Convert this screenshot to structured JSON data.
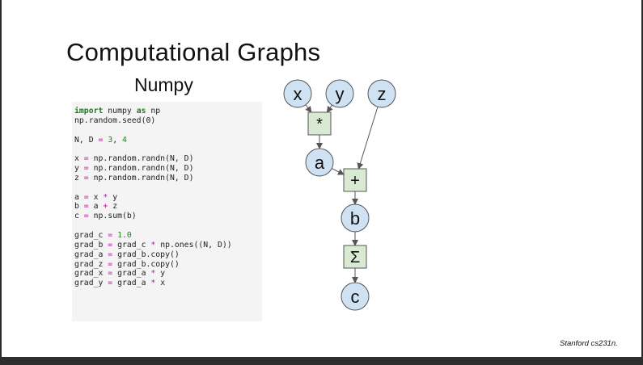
{
  "slide": {
    "title": "Computational Graphs",
    "subtitle": "Numpy",
    "credit": "Stanford cs231n."
  },
  "code": [
    [
      {
        "t": "import",
        "c": "kw"
      },
      {
        "t": " numpy "
      },
      {
        "t": "as",
        "c": "kw"
      },
      {
        "t": " np"
      }
    ],
    [
      {
        "t": "np.random.seed(0)"
      }
    ],
    [],
    [
      {
        "t": "N, D "
      },
      {
        "t": "=",
        "c": "op"
      },
      {
        "t": " "
      },
      {
        "t": "3",
        "c": "num"
      },
      {
        "t": ", "
      },
      {
        "t": "4",
        "c": "num"
      }
    ],
    [],
    [
      {
        "t": "x "
      },
      {
        "t": "=",
        "c": "op"
      },
      {
        "t": " np.random.randn(N, D)"
      }
    ],
    [
      {
        "t": "y "
      },
      {
        "t": "=",
        "c": "op"
      },
      {
        "t": " np.random.randn(N, D)"
      }
    ],
    [
      {
        "t": "z "
      },
      {
        "t": "=",
        "c": "op"
      },
      {
        "t": " np.random.randn(N, D)"
      }
    ],
    [],
    [
      {
        "t": "a "
      },
      {
        "t": "=",
        "c": "op"
      },
      {
        "t": " x "
      },
      {
        "t": "*",
        "c": "op"
      },
      {
        "t": " y"
      }
    ],
    [
      {
        "t": "b "
      },
      {
        "t": "=",
        "c": "op"
      },
      {
        "t": " a "
      },
      {
        "t": "+",
        "c": "op"
      },
      {
        "t": " z"
      }
    ],
    [
      {
        "t": "c "
      },
      {
        "t": "=",
        "c": "op"
      },
      {
        "t": " np.sum(b)"
      }
    ],
    [],
    [
      {
        "t": "grad_c "
      },
      {
        "t": "=",
        "c": "op"
      },
      {
        "t": " "
      },
      {
        "t": "1.0",
        "c": "num"
      }
    ],
    [
      {
        "t": "grad_b "
      },
      {
        "t": "=",
        "c": "op"
      },
      {
        "t": " grad_c "
      },
      {
        "t": "*",
        "c": "op"
      },
      {
        "t": " np.ones((N, D))"
      }
    ],
    [
      {
        "t": "grad_a "
      },
      {
        "t": "=",
        "c": "op"
      },
      {
        "t": " grad_b.copy()"
      }
    ],
    [
      {
        "t": "grad_z "
      },
      {
        "t": "=",
        "c": "op"
      },
      {
        "t": " grad_b.copy()"
      }
    ],
    [
      {
        "t": "grad_x "
      },
      {
        "t": "=",
        "c": "op"
      },
      {
        "t": " grad_a "
      },
      {
        "t": "*",
        "c": "op"
      },
      {
        "t": " y"
      }
    ],
    [
      {
        "t": "grad_y "
      },
      {
        "t": "=",
        "c": "op"
      },
      {
        "t": " grad_a "
      },
      {
        "t": "*",
        "c": "op"
      },
      {
        "t": " x"
      }
    ]
  ],
  "graph": {
    "nodes": [
      {
        "id": "x",
        "label": "x",
        "kind": "variable"
      },
      {
        "id": "y",
        "label": "y",
        "kind": "variable"
      },
      {
        "id": "z",
        "label": "z",
        "kind": "variable"
      },
      {
        "id": "mul",
        "label": "*",
        "kind": "operation"
      },
      {
        "id": "a",
        "label": "a",
        "kind": "variable"
      },
      {
        "id": "add",
        "label": "+",
        "kind": "operation"
      },
      {
        "id": "b",
        "label": "b",
        "kind": "variable"
      },
      {
        "id": "sum",
        "label": "Σ",
        "kind": "operation"
      },
      {
        "id": "c",
        "label": "c",
        "kind": "variable"
      }
    ],
    "edges": [
      {
        "from": "x",
        "to": "mul"
      },
      {
        "from": "y",
        "to": "mul"
      },
      {
        "from": "mul",
        "to": "a"
      },
      {
        "from": "a",
        "to": "add"
      },
      {
        "from": "z",
        "to": "add"
      },
      {
        "from": "add",
        "to": "b"
      },
      {
        "from": "b",
        "to": "sum"
      },
      {
        "from": "sum",
        "to": "c"
      }
    ],
    "colors": {
      "variable_fill": "#cfe2f3",
      "operation_fill": "#d9ead3",
      "stroke": "#555555"
    }
  }
}
